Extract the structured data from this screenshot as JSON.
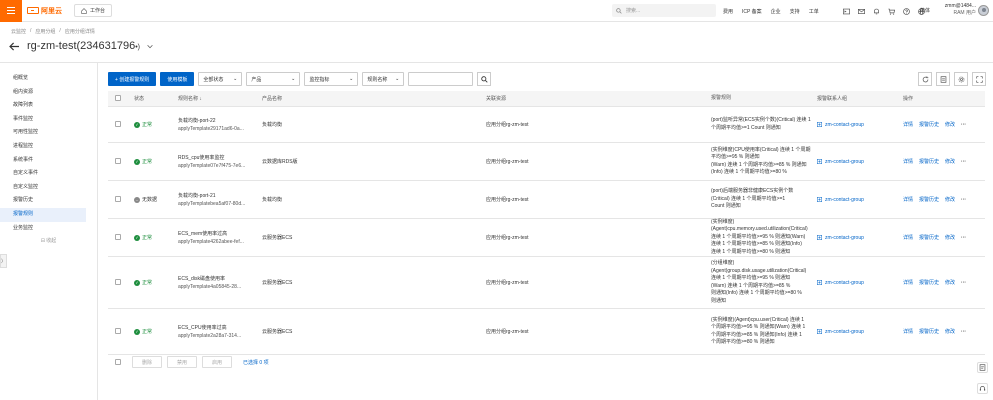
{
  "topbar": {
    "logo_text": "阿里云",
    "workbench": "工作台",
    "search_placeholder": "搜索...",
    "links": [
      "费用",
      "ICP 备案",
      "企业",
      "支持",
      "工单"
    ],
    "lang": "简体",
    "user_name": "zmm@1484...",
    "user_role": "RAM 用户"
  },
  "breadcrumb": [
    "云监控",
    "/",
    "应用分组",
    "/",
    "应用分组详情"
  ],
  "page": {
    "title": "rg-zm-test(234631796",
    "title_suffix": "•)"
  },
  "sidebar": {
    "items": [
      "组概览",
      "组内资源",
      "故障列表",
      "事件监控",
      "可用性监控",
      "进程监控",
      "系统事件",
      "自定义事件",
      "自定义监控",
      "报警历史",
      "报警规则",
      "业务监控"
    ],
    "active_index": 10,
    "collapse": "收起",
    "tab": "〉"
  },
  "toolbar": {
    "create": "+ 创建报警规则",
    "use_template": "使用模板",
    "filters": [
      "全部状态",
      "产品",
      "监控指标",
      "规则名称"
    ]
  },
  "table": {
    "headers": [
      "",
      "状态",
      "规则名称 ↓",
      "产品名称",
      "关联资源",
      "报警规则",
      "报警联系人组",
      "操作"
    ],
    "rows": [
      {
        "status": "正常",
        "ok": true,
        "name1": "负载均衡-port-22",
        "name2": "applyTemplate29171ad6-0a...",
        "product": "负载均衡",
        "resource": "应用分组rg-zm-test",
        "rule": [
          "(port)监听异常(ECS实例个数)(Critical) 连续 1 个周期平均值>=1 Count 则通知"
        ],
        "contact": "zm-contact-group",
        "h": 36
      },
      {
        "status": "正常",
        "ok": true,
        "name1": "RDS_cpu使用率监控",
        "name2": "applyTemplate07e7f475-7e6...",
        "product": "云数据库RDS版",
        "resource": "应用分组rg-zm-test",
        "rule": [
          "(实例维度)CPU使用率(Critical) 连续 1 个周期平均值>=95 % 则通知",
          "(Warn) 连续 1 个周期平均值>=85 % 则通知",
          "(Info) 连续 1 个周期平均值>=80 %"
        ],
        "contact": "zm-contact-group",
        "h": 38
      },
      {
        "status": "无数据",
        "ok": false,
        "name1": "负载均衡-port-21",
        "name2": "applyTemplatebea5af07-80d...",
        "product": "负载均衡",
        "resource": "应用分组rg-zm-test",
        "rule": [
          "(port)后端服务器非健康ECS实例个数",
          "(Critical) 连续 1 个周期平均值>=1",
          "Count 则通知"
        ],
        "contact": "zm-contact-group",
        "h": 38
      },
      {
        "status": "正常",
        "ok": true,
        "name1": "ECS_mem使用率过高",
        "name2": "applyTemplate4262abee-fef...",
        "product": "云服务器ECS",
        "resource": "应用分组rg-zm-test",
        "rule": [
          "(实例维度)",
          "(Agent)cpu.memory.used.utilization(Critical)",
          "连续 1 个周期平均值>=95 % 则通知(Warn)",
          "连续 1 个周期平均值>=85 % 则通知(Info)",
          "连续 1 个周期平均值>=80 % 则通知"
        ],
        "contact": "zm-contact-group",
        "h": 38
      },
      {
        "status": "正常",
        "ok": true,
        "name1": "ECS_disk磁盘使用率",
        "name2": "applyTemplate4a05845-28...",
        "product": "云服务器ECS",
        "resource": "应用分组rg-zm-test",
        "rule": [
          "(分组维度)",
          "(Agent)group.disk.usage.utilization(Critical)",
          "连续 1 个周期平均值>=95 % 则通知",
          "(Warn) 连续 1 个周期平均值>=85 %",
          "则通知(Info) 连续 1 个周期平均值>=80 %",
          "则通知"
        ],
        "contact": "zm-contact-group",
        "h": 52
      },
      {
        "status": "正常",
        "ok": true,
        "name1": "ECS_CPU使用率过高",
        "name2": "applyTemplate2a28a7-314...",
        "product": "云服务器ECS",
        "resource": "应用分组rg-zm-test",
        "rule": [
          "(实例维度)(Agent)cpu.user(Critical) 连续 1",
          "个周期平均值>=95 % 则通知(Warn) 连续 1",
          "个周期平均值>=85 % 则通知(Info) 连续 1",
          "个周期平均值>=80 % 则通知"
        ],
        "contact": "zm-contact-group",
        "h": 46
      }
    ],
    "actions": [
      "详情",
      "报警历史",
      "修改"
    ]
  },
  "footer": {
    "buttons": [
      "删除",
      "禁用",
      "启用"
    ],
    "selected": "已选择 0 项"
  }
}
